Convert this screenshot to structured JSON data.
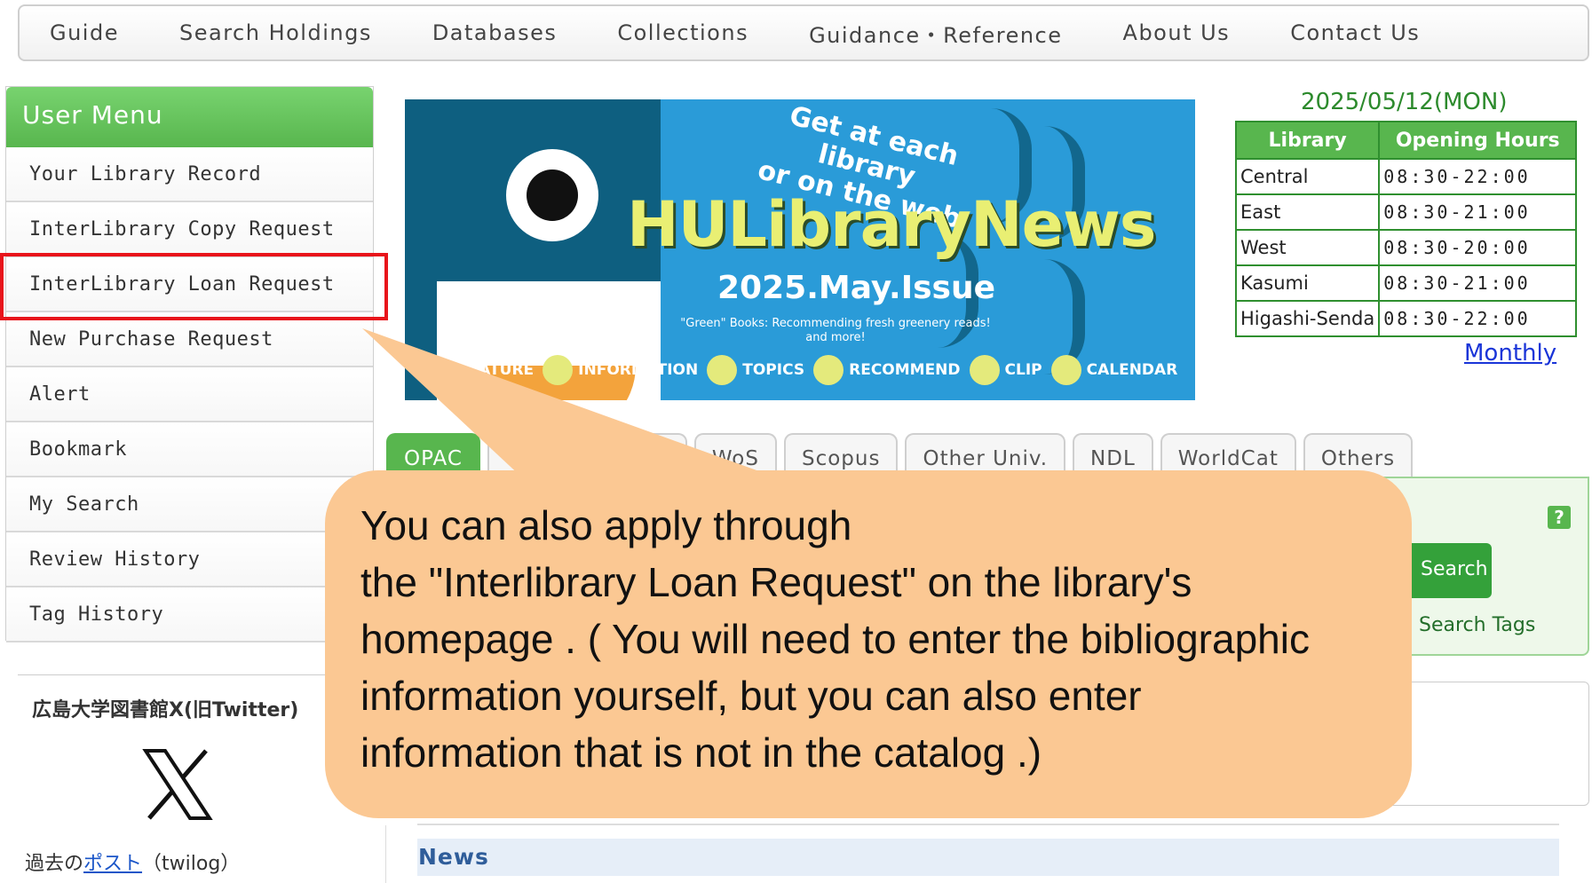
{
  "nav": {
    "items": [
      "Guide",
      "Search Holdings",
      "Databases",
      "Collections",
      "Guidance・Reference",
      "About Us",
      "Contact Us"
    ]
  },
  "user_menu": {
    "title": "User Menu",
    "items": [
      "Your Library Record",
      "InterLibrary Copy Request",
      "InterLibrary Loan Request",
      "New Purchase Request",
      "Alert",
      "Bookmark",
      "My Search",
      "Review History",
      "Tag History"
    ],
    "highlighted_item": "InterLibrary Loan Request"
  },
  "twitter": {
    "title": "広島大学図書館X(旧Twitter)",
    "post_prefix": "過去の",
    "post_link": "ポスト",
    "post_suffix": "（twilog）"
  },
  "banner": {
    "tagline_1": "Get at each library",
    "tagline_2": "or on the web",
    "title": "HULibraryNews",
    "issue": "2025.May.Issue",
    "subtitle_1": "\"Green\" Books: Recommending fresh greenery reads!",
    "subtitle_2": "and more!",
    "sections": [
      "FEATURE",
      "INFORMATION",
      "TOPICS",
      "RECOMMEND",
      "CLIP",
      "CALENDAR"
    ]
  },
  "hours": {
    "date": "2025/05/12(MON)",
    "headers": [
      "Library",
      "Opening Hours"
    ],
    "rows": [
      [
        "Central",
        "08:30-22:00"
      ],
      [
        "East",
        "08:30-21:00"
      ],
      [
        "West",
        "08:30-20:00"
      ],
      [
        "Kasumi",
        "08:30-21:00"
      ],
      [
        "Higashi-Senda",
        "08:30-22:00"
      ]
    ],
    "monthly_link": "Monthly"
  },
  "tabs": {
    "items": [
      "OPAC",
      "",
      "WoS",
      "Scopus",
      "Other Univ.",
      "NDL",
      "WorldCat",
      "Others"
    ]
  },
  "search": {
    "help": "?",
    "button": "Search",
    "tags_link": "Search Tags"
  },
  "news": {
    "label": "News"
  },
  "callout": {
    "lines": [
      "You can also apply through",
      "the \"Interlibrary Loan Request\" on the library's",
      "homepage . ( You will need to enter the bibliographic",
      "information yourself, but you can also enter",
      "information that is not in the catalog .)"
    ]
  },
  "colors": {
    "menu_green": "#58b64e",
    "highlight_red": "#e8141b",
    "callout_orange": "#fbc893",
    "banner_blue": "#2a9bd8",
    "link_blue": "#1a35d8"
  }
}
